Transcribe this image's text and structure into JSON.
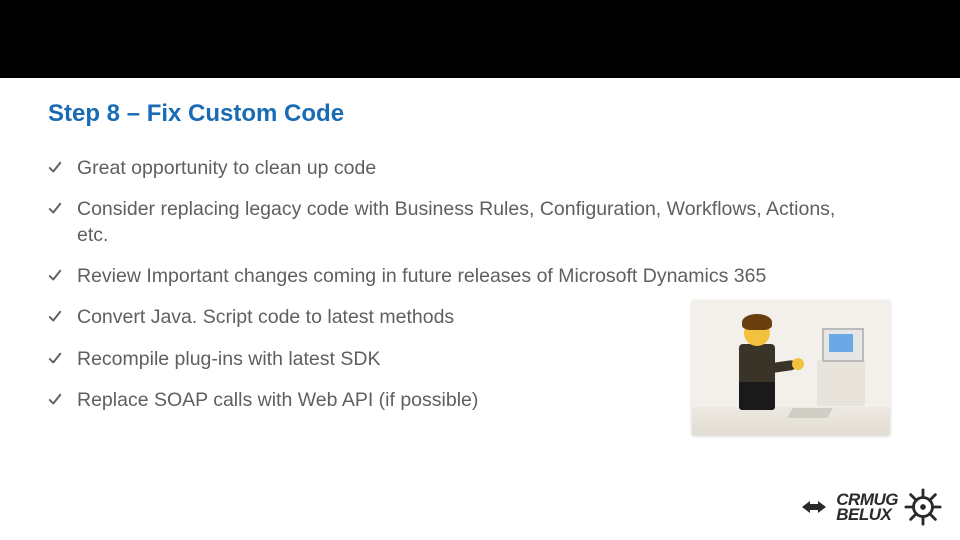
{
  "topBar": {},
  "title": "Step 8 – Fix Custom Code",
  "bullets": [
    "Great opportunity to clean up code",
    "Consider replacing legacy code with Business Rules, Configuration, Workflows, Actions, etc.",
    "Review Important changes coming in future releases of Microsoft Dynamics 365",
    "Convert Java. Script code to latest methods",
    "Recompile plug-ins with latest SDK",
    "Replace SOAP calls with Web API (if possible)"
  ],
  "imageAlt": "LEGO minifigure sitting at a computer desk",
  "logo": {
    "line1": "CRMUG",
    "line2": "BELUX"
  },
  "colors": {
    "title": "#1a6bb5",
    "bulletText": "#5f5f5f",
    "check": "#5f5f5f"
  }
}
